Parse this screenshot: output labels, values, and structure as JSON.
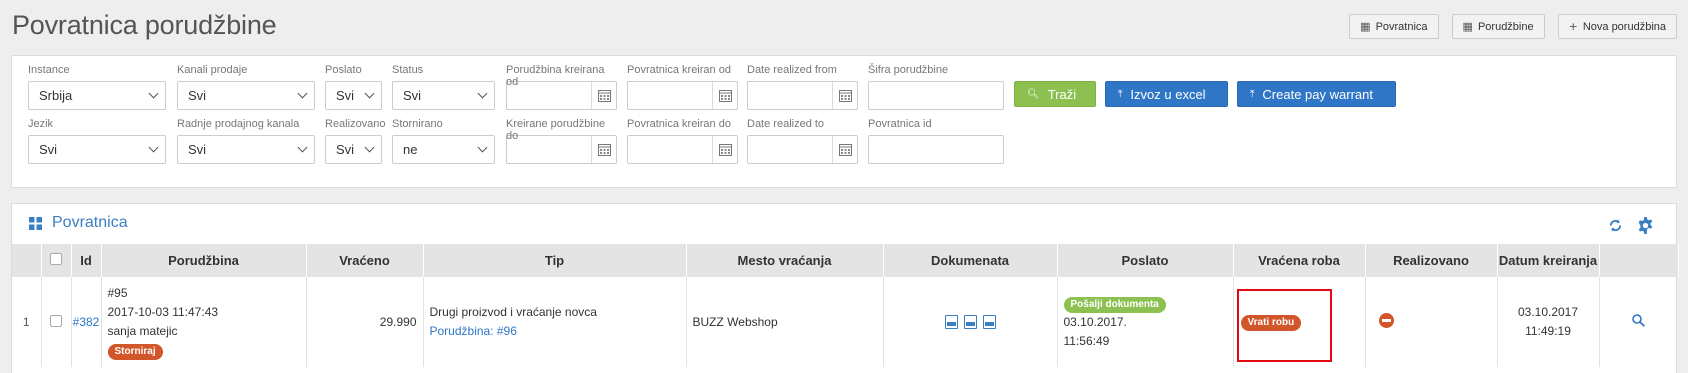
{
  "page": {
    "title": "Povratnica porudžbine"
  },
  "top_actions": [
    {
      "label": "Povratnica",
      "icon": "table-icon"
    },
    {
      "label": "Porudžbine",
      "icon": "table-icon"
    },
    {
      "label": "Nova porudžbina",
      "icon": "plus-icon"
    }
  ],
  "filters": {
    "instance": {
      "label": "Instance",
      "value": "Srbija"
    },
    "kanali": {
      "label": "Kanali prodaje",
      "value": "Svi"
    },
    "poslato": {
      "label": "Poslato",
      "value": "Svi"
    },
    "status": {
      "label": "Status",
      "value": "Svi"
    },
    "porudzbina_od": {
      "label": "Porudžbina kreirana od",
      "value": ""
    },
    "povratnica_od": {
      "label": "Povratnica kreiran od",
      "value": ""
    },
    "realized_from": {
      "label": "Date realized from",
      "value": ""
    },
    "sifra": {
      "label": "Šifra porudžbine",
      "value": ""
    },
    "jezik": {
      "label": "Jezik",
      "value": "Svi"
    },
    "radnje": {
      "label": "Radnje prodajnog kanala",
      "value": "Svi"
    },
    "realizovano": {
      "label": "Realizovano",
      "value": "Svi"
    },
    "stornirano": {
      "label": "Stornirano",
      "value": "ne"
    },
    "porudzbine_do": {
      "label": "Kreirane porudžbine do",
      "value": ""
    },
    "povratnica_do": {
      "label": "Povratnica kreiran do",
      "value": ""
    },
    "realized_to": {
      "label": "Date realized to",
      "value": ""
    },
    "povratnica_id": {
      "label": "Povratnica id",
      "value": ""
    }
  },
  "buttons": {
    "search": "Traži",
    "excel": "Izvoz u excel",
    "pay_warrant": "Create pay warrant"
  },
  "grid": {
    "title": "Povratnica",
    "columns": [
      "",
      "",
      "Id",
      "Porudžbina",
      "Vraćeno",
      "Tip",
      "Mesto vraćanja",
      "Dokumenata",
      "Poslato",
      "Vraćena roba",
      "Realizovano",
      "Datum kreiranja",
      ""
    ],
    "rows": [
      {
        "index": "1",
        "id": "#382",
        "order_no": "#95",
        "order_date": "2017-10-03 11:47:43",
        "customer": "sanja matejic",
        "storno_badge": "Storniraj",
        "returned": "29.990",
        "type": "Drugi proizvod i vraćanje novca",
        "order_link": "Porudžbina: #96",
        "place": "BUZZ Webshop",
        "send_docs_badge": "Pošalji dokumenta",
        "sent_date": "03.10.2017.",
        "sent_time": "11:56:49",
        "return_goods_badge": "Vrati robu",
        "created_date": "03.10.2017",
        "created_time": "11:49:19"
      }
    ]
  },
  "colors": {
    "accent": "#2f76c7",
    "green": "#8cc152",
    "danger": "#d3562a",
    "highlight": "#e30613"
  }
}
